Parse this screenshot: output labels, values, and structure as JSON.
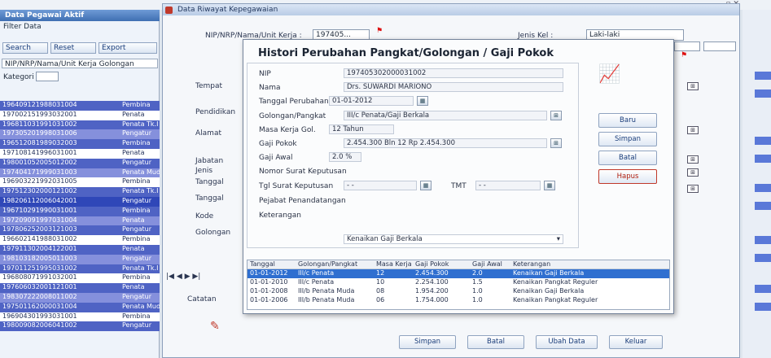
{
  "window_controls": "_ ▫ ✕",
  "left_panel": {
    "title": "Data Pegawai Aktif",
    "menu": "Filter Data",
    "buttons": [
      "Search",
      "Reset",
      "Export"
    ],
    "filter_header": "NIP/NRP/Nama/Unit Kerja   Golongan",
    "kategori_label": "Kategori",
    "rows": [
      {
        "c1": "196409121988031004",
        "c2": "Pembina"
      },
      {
        "c1": "197002151993032001",
        "c2": "Penata"
      },
      {
        "c1": "196811031991031002",
        "c2": "Penata Tk.I"
      },
      {
        "c1": "197305201998031006",
        "c2": "Pengatur"
      },
      {
        "c1": "196512081989032003",
        "c2": "Pembina"
      },
      {
        "c1": "197108141996031001",
        "c2": "Penata"
      },
      {
        "c1": "198001052005012002",
        "c2": "Pengatur"
      },
      {
        "c1": "197404171999031003",
        "c2": "Penata Muda"
      },
      {
        "c1": "196903221992031005",
        "c2": "Pembina"
      },
      {
        "c1": "197512302000121002",
        "c2": "Penata Tk.I"
      },
      {
        "c1": "198206112006042001",
        "c2": "Pengatur"
      },
      {
        "c1": "196710291990031001",
        "c2": "Pembina"
      },
      {
        "c1": "197209091997031004",
        "c2": "Penata"
      },
      {
        "c1": "197806252003121003",
        "c2": "Pengatur"
      },
      {
        "c1": "196602141988031002",
        "c2": "Pembina"
      },
      {
        "c1": "197911302004122001",
        "c2": "Penata"
      },
      {
        "c1": "198103182005011003",
        "c2": "Pengatur"
      },
      {
        "c1": "197011251995031002",
        "c2": "Penata Tk.I"
      },
      {
        "c1": "196808071991032001",
        "c2": "Pembina"
      },
      {
        "c1": "197606032001121001",
        "c2": "Penata"
      },
      {
        "c1": "198307222008011002",
        "c2": "Pengatur"
      },
      {
        "c1": "197501162000031004",
        "c2": "Penata Muda"
      },
      {
        "c1": "196904301993031001",
        "c2": "Pembina"
      },
      {
        "c1": "198009082006041002",
        "c2": "Pengatur"
      }
    ]
  },
  "main_window": {
    "title": "Data Riwayat Kepegawaian",
    "nip_label": "NIP/NRP/Nama/Unit Kerja :",
    "nip_value": "197405...",
    "jenis_label": "Jenis Kel :",
    "jenis_value": "Laki-laki",
    "side_labels": [
      "Tempat",
      "Pendidikan",
      "Alamat",
      "Jabatan",
      "Jenis",
      "Tanggal",
      "Tanggal",
      "Kode",
      "Golongan"
    ],
    "pager": "|◀ ◀ ▶ ▶|",
    "catatan_label": "Catatan",
    "bottom_buttons": [
      "Simpan",
      "Batal",
      "Ubah Data",
      "Keluar"
    ]
  },
  "dialog": {
    "title": "Histori Perubahan Pangkat/Golongan / Gaji Pokok",
    "fields": [
      {
        "label": "NIP",
        "value": "197405302000031002"
      },
      {
        "label": "Nama",
        "value": "Drs. SUWARDI MARIONO"
      },
      {
        "label": "Tanggal Perubahan",
        "value": "01-01-2012"
      },
      {
        "label": "Golongan/Pangkat",
        "value": "III/c   Penata/Gaji Berkala"
      },
      {
        "label": "Masa Kerja Gol.",
        "value": "12   Tahun"
      },
      {
        "label": "Gaji Pokok",
        "value": "2.454.300   Bln   12   Rp 2.454.300"
      },
      {
        "label": "Gaji Awal",
        "value": "2.0 %"
      },
      {
        "label": "Nomor Surat Keputusan",
        "value": ""
      },
      {
        "label": "Tgl Surat Keputusan",
        "value": "- -"
      },
      {
        "label": "Pejabat Penandatangan",
        "value": ""
      },
      {
        "label": "Keterangan",
        "value": ""
      }
    ],
    "tmt_label": "TMT",
    "tmt_value": "- -",
    "jenis_select": "Kenaikan Gaji Berkala",
    "buttons": [
      "Baru",
      "Simpan",
      "Batal",
      "Hapus"
    ],
    "table": {
      "headers": [
        "Tanggal",
        "Golongan/Pangkat",
        "Masa Kerja",
        "Gaji Pokok",
        "Gaji Awal",
        "Keterangan"
      ],
      "rows": [
        {
          "tanggal": "01-01-2012",
          "golongan": "III/c Penata",
          "masa": "12",
          "gaji": "2.454.300",
          "awal": "2.0",
          "ket": "Kenaikan Gaji Berkala",
          "selected": true
        },
        {
          "tanggal": "01-01-2010",
          "golongan": "III/c Penata",
          "masa": "10",
          "gaji": "2.254.100",
          "awal": "1.5",
          "ket": "Kenaikan Pangkat Reguler"
        },
        {
          "tanggal": "01-01-2008",
          "golongan": "III/b Penata Muda",
          "masa": "08",
          "gaji": "1.954.200",
          "awal": "1.0",
          "ket": "Kenaikan Gaji Berkala"
        },
        {
          "tanggal": "01-01-2006",
          "golongan": "III/b Penata Muda",
          "masa": "06",
          "gaji": "1.754.000",
          "awal": "1.0",
          "ket": "Kenaikan Pangkat Reguler"
        }
      ]
    }
  },
  "colors": {
    "accent": "#2f6fd0",
    "row_purple": "#4f63c4",
    "row_light": "#8590dc"
  }
}
